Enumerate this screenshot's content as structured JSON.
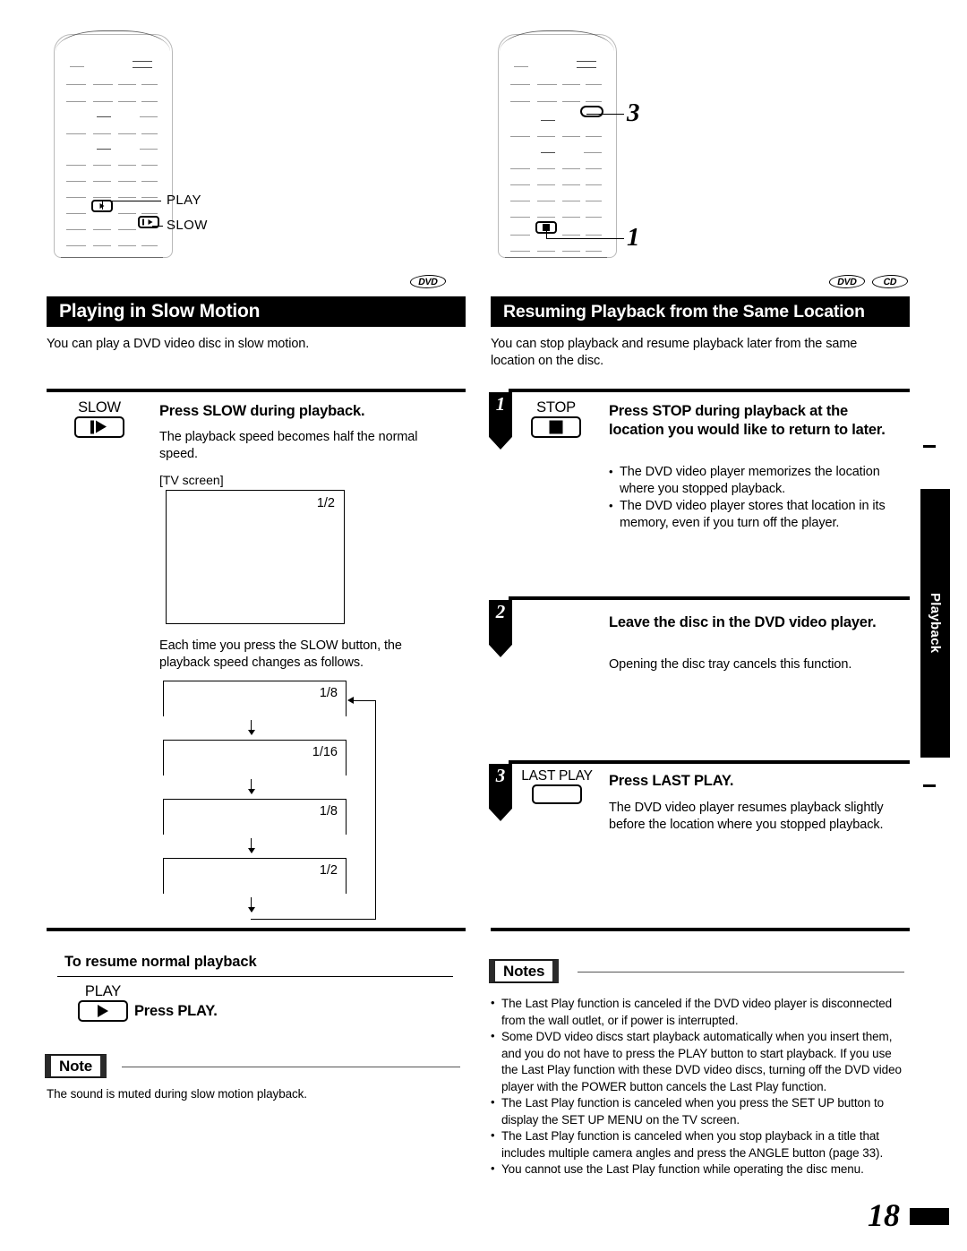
{
  "page": {
    "number": "18",
    "side_tab": "Playback"
  },
  "left_column": {
    "remote": {
      "callouts": [
        {
          "label": "PLAY"
        },
        {
          "label": "SLOW"
        }
      ]
    },
    "section": {
      "title": "Playing in Slow Motion",
      "badges": [
        "DVD"
      ],
      "intro": "You can play a DVD video disc in slow motion."
    },
    "step": {
      "button_caption": "SLOW",
      "button_icon": "slow-playback-icon",
      "heading": "Press SLOW during playback.",
      "body": "The playback speed becomes half the normal speed."
    },
    "tv": {
      "label": "[TV screen]",
      "value": "1/2"
    },
    "sequence_intro": "Each time you press the SLOW button, the playback speed changes as follows.",
    "sequence": {
      "steps": [
        "1/8",
        "1/16",
        "1/8",
        "1/2"
      ],
      "loops": true
    },
    "resume": {
      "heading": "To resume normal playback",
      "button_caption": "PLAY",
      "button_icon": "play-icon",
      "instruction": "Press PLAY."
    },
    "note": {
      "badge": "Note",
      "items": [
        "The sound is muted during slow motion playback."
      ]
    }
  },
  "right_column": {
    "remote": {
      "callouts": [
        {
          "label": "3"
        },
        {
          "label": "1"
        }
      ]
    },
    "section": {
      "title": "Resuming Playback from the Same Location",
      "badges": [
        "DVD",
        "CD"
      ],
      "intro": "You can stop playback and resume playback later from the same location on the disc."
    },
    "steps": [
      {
        "number": "1",
        "button_caption": "STOP",
        "button_icon": "stop-icon",
        "heading": "Press STOP during playback at the location you would like to return to later.",
        "bullets": [
          "The DVD video player memorizes the location where you stopped playback.",
          "The DVD video player stores that location in its memory, even if you turn off the player."
        ]
      },
      {
        "number": "2",
        "button_caption": "",
        "button_icon": "",
        "heading": "Leave the disc in the DVD video player.",
        "body": "Opening the disc tray cancels this function."
      },
      {
        "number": "3",
        "button_caption": "LAST PLAY",
        "button_icon": "blank-button-icon",
        "heading": "Press LAST PLAY.",
        "body": "The DVD video player resumes playback slightly before the location where you stopped playback."
      }
    ],
    "notes": {
      "badge": "Notes",
      "items": [
        "The Last Play function is canceled if the DVD video player is disconnected from the wall outlet, or if power is interrupted.",
        "Some DVD video discs start playback automatically when you insert them, and you do not have to press the PLAY button to start playback. If you use the Last Play function with these DVD video discs, turning off the DVD video player with the POWER button cancels the Last Play function.",
        "The Last Play function is canceled when you press the SET UP button to display the SET UP MENU on the TV screen.",
        "The Last Play function is canceled when you stop playback in a title that includes multiple camera angles and press the ANGLE button (page 33).",
        "You cannot use the Last Play function while operating the disc menu."
      ]
    }
  }
}
